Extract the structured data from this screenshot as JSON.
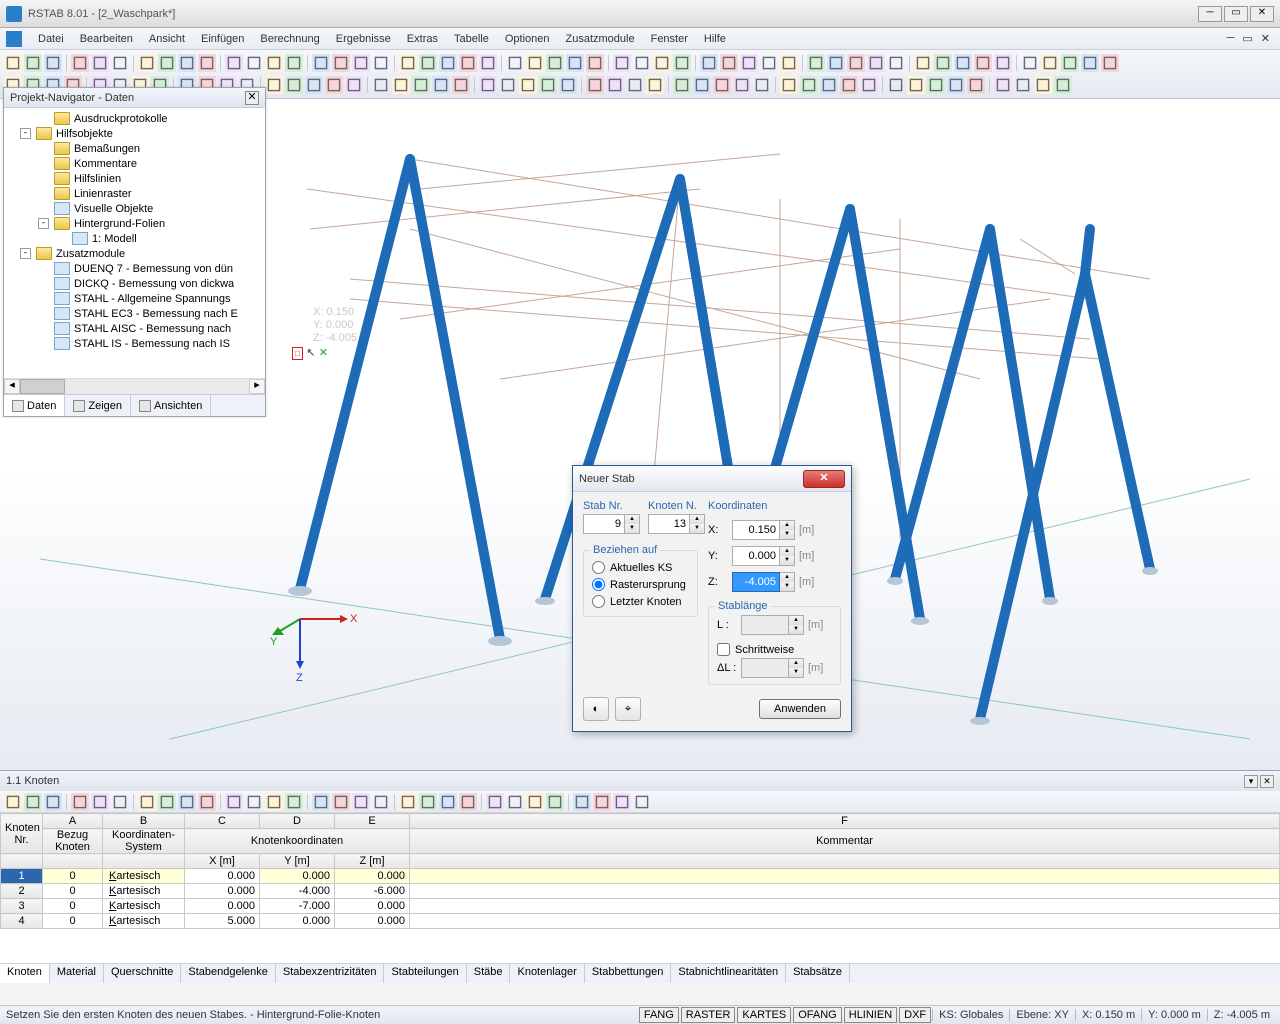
{
  "window": {
    "title": "RSTAB 8.01 - [2_Waschpark*]"
  },
  "menu": {
    "items": [
      "Datei",
      "Bearbeiten",
      "Ansicht",
      "Einfügen",
      "Berechnung",
      "Ergebnisse",
      "Extras",
      "Tabelle",
      "Optionen",
      "Zusatzmodule",
      "Fenster",
      "Hilfe"
    ]
  },
  "navigator": {
    "title": "Projekt-Navigator - Daten",
    "tree": [
      {
        "indent": 1,
        "icon": "folder",
        "label": "Ausdruckprotokolle"
      },
      {
        "indent": 0,
        "expander": "-",
        "icon": "folder",
        "label": "Hilfsobjekte"
      },
      {
        "indent": 1,
        "icon": "folder",
        "label": "Bemaßungen"
      },
      {
        "indent": 1,
        "icon": "folder",
        "label": "Kommentare"
      },
      {
        "indent": 1,
        "icon": "folder",
        "label": "Hilfslinien"
      },
      {
        "indent": 1,
        "icon": "folder",
        "label": "Linienraster"
      },
      {
        "indent": 1,
        "icon": "file",
        "label": "Visuelle Objekte"
      },
      {
        "indent": 1,
        "expander": "-",
        "icon": "folder",
        "label": "Hintergrund-Folien"
      },
      {
        "indent": 2,
        "icon": "file",
        "label": "1: Modell"
      },
      {
        "indent": 0,
        "expander": "-",
        "icon": "folder",
        "label": "Zusatzmodule"
      },
      {
        "indent": 1,
        "icon": "file",
        "label": "DUENQ 7 - Bemessung von dün"
      },
      {
        "indent": 1,
        "icon": "file",
        "label": "DICKQ - Bemessung von dickwa"
      },
      {
        "indent": 1,
        "icon": "file",
        "label": "STAHL - Allgemeine Spannungs"
      },
      {
        "indent": 1,
        "icon": "file",
        "label": "STAHL EC3 - Bemessung nach E"
      },
      {
        "indent": 1,
        "icon": "file",
        "label": "STAHL AISC - Bemessung nach"
      },
      {
        "indent": 1,
        "icon": "file",
        "label": "STAHL IS - Bemessung nach IS"
      }
    ],
    "tabs": [
      {
        "label": "Daten",
        "active": true
      },
      {
        "label": "Zeigen",
        "active": false
      },
      {
        "label": "Ansichten",
        "active": false
      }
    ]
  },
  "viewport": {
    "coord_lines": [
      "X:   0.150",
      "Y:   0.000",
      "Z:  -4.005"
    ],
    "axes": {
      "x": "X",
      "y": "Y",
      "z": "Z"
    }
  },
  "dialog": {
    "title": "Neuer Stab",
    "stab_nr_label": "Stab Nr.",
    "stab_nr": "9",
    "knoten_label": "Knoten N.",
    "knoten": "13",
    "koordinaten_label": "Koordinaten",
    "coords": {
      "x_label": "X:",
      "x": "0.150",
      "x_unit": "[m]",
      "y_label": "Y:",
      "y": "0.000",
      "y_unit": "[m]",
      "z_label": "Z:",
      "z": "-4.005",
      "z_unit": "[m]"
    },
    "bezug_title": "Beziehen auf",
    "radio_aktuell": "Aktuelles KS",
    "radio_raster": "Rasterursprung",
    "radio_letzter": "Letzter Knoten",
    "stablange_title": "Stablänge",
    "stablange_label": "L :",
    "stablange_unit": "[m]",
    "schritt_label": "Schrittweise",
    "delta_label": "ΔL :",
    "delta_unit": "[m]",
    "apply_btn": "Anwenden"
  },
  "bottom": {
    "title": "1.1 Knoten",
    "col_letters": [
      "A",
      "B",
      "C",
      "D",
      "E",
      "F"
    ],
    "headers": {
      "knoten_nr": "Knoten\nNr.",
      "bezug": "Bezug\nKnoten",
      "system": "Koordinaten-\nSystem",
      "koordinaten": "Knotenkoordinaten",
      "x": "X [m]",
      "y": "Y [m]",
      "z": "Z [m]",
      "kommentar": "Kommentar"
    },
    "rows": [
      {
        "nr": "1",
        "bezug": "0",
        "sys": "Kartesisch",
        "x": "0.000",
        "y": "0.000",
        "z": "0.000",
        "sel": true
      },
      {
        "nr": "2",
        "bezug": "0",
        "sys": "Kartesisch",
        "x": "0.000",
        "y": "-4.000",
        "z": "-6.000"
      },
      {
        "nr": "3",
        "bezug": "0",
        "sys": "Kartesisch",
        "x": "0.000",
        "y": "-7.000",
        "z": "0.000"
      },
      {
        "nr": "4",
        "bezug": "0",
        "sys": "Kartesisch",
        "x": "5.000",
        "y": "0.000",
        "z": "0.000"
      }
    ],
    "tabs": [
      "Knoten",
      "Material",
      "Querschnitte",
      "Stabendgelenke",
      "Stabexzentrizitäten",
      "Stabteilungen",
      "Stäbe",
      "Knotenlager",
      "Stabbettungen",
      "Stabnichtlinearitäten",
      "Stabsätze"
    ]
  },
  "statusbar": {
    "msg": "Setzen Sie den ersten Knoten des neuen Stabes. - Hintergrund-Folie-Knoten",
    "toggles": [
      "FANG",
      "RASTER",
      "KARTES",
      "OFANG",
      "HLINIEN",
      "DXF"
    ],
    "ks": "KS: Globales ",
    "ebene": "Ebene: XY",
    "x": "X: 0.150 m",
    "y": "Y: 0.000 m",
    "z": "Z: -4.005 m"
  }
}
